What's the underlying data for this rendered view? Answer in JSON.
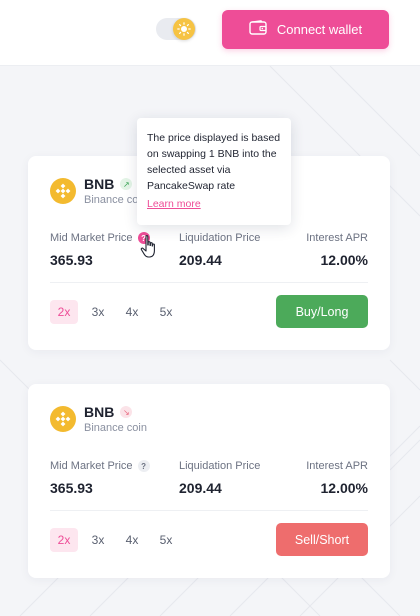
{
  "header": {
    "theme_toggle": {
      "icon": "sun-icon",
      "state": "light"
    },
    "connect_wallet": {
      "label": "Connect wallet",
      "icon": "wallet-icon"
    }
  },
  "colors": {
    "accent": "#ee4d97",
    "long": "#4caa5a",
    "short": "#ee6d6d",
    "bnb": "#f3ba2f"
  },
  "cards": [
    {
      "asset": {
        "symbol": "BNB",
        "name": "Binance coin",
        "trend": "up"
      },
      "stats": [
        {
          "label": "Mid Market Price",
          "value": "365.93",
          "help": true
        },
        {
          "label": "Liquidation Price",
          "value": "209.44",
          "help": false
        },
        {
          "label": "Interest APR",
          "value": "12.00%",
          "help": false
        }
      ],
      "leverage": {
        "options": [
          "2x",
          "3x",
          "4x",
          "5x"
        ],
        "selected": "2x"
      },
      "action": "Buy/Long"
    },
    {
      "asset": {
        "symbol": "BNB",
        "name": "Binance coin",
        "trend": "down"
      },
      "stats": [
        {
          "label": "Mid Market Price",
          "value": "365.93",
          "help": true
        },
        {
          "label": "Liquidation Price",
          "value": "209.44",
          "help": false
        },
        {
          "label": "Interest APR",
          "value": "12.00%",
          "help": false
        }
      ],
      "leverage": {
        "options": [
          "2x",
          "3x",
          "4x",
          "5x"
        ],
        "selected": "2x"
      },
      "action": "Sell/Short"
    }
  ],
  "tooltip": {
    "help_icon_glyph": "?",
    "text": "The price displayed is based on swapping 1 BNB into the selected asset via PancakeSwap rate",
    "link": "Learn more"
  }
}
